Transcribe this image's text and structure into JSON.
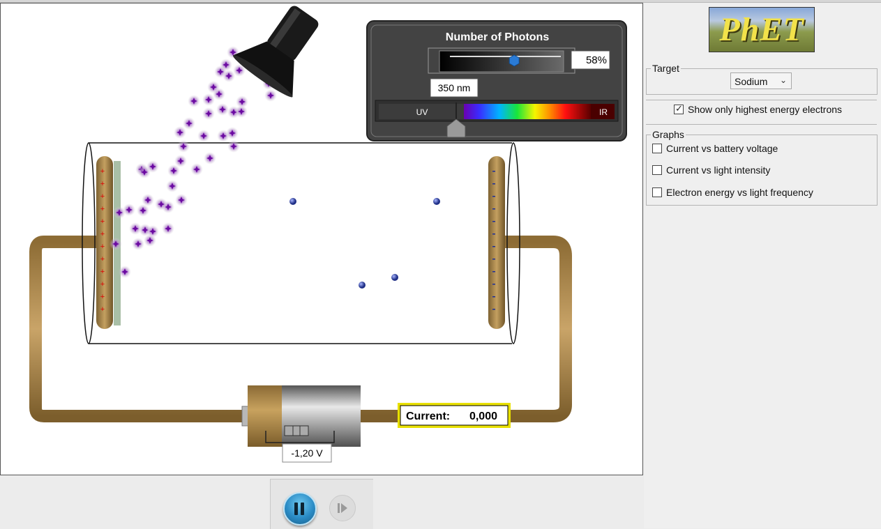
{
  "simulation": {
    "photon_panel": {
      "title": "Number of Photons",
      "intensity_percent": 58,
      "intensity_label": "58%",
      "wavelength_label": "350 nm",
      "spectrum_uv_label": "UV",
      "spectrum_ir_label": "IR"
    },
    "battery": {
      "voltage_label": "-1,20 V"
    },
    "ammeter": {
      "label": "Current:",
      "value": "0,000"
    },
    "colors": {
      "wire": "#a07d45",
      "photon": "#7a1fa8",
      "electron": "#2b3f9a",
      "current_border": "#e8e000"
    }
  },
  "sidebar": {
    "logo_text": "PhET",
    "target": {
      "legend": "Target",
      "selected": "Sodium",
      "icon": "chevron-down-icon"
    },
    "show_highest_label": "Show only highest energy electrons",
    "graphs": {
      "legend": "Graphs",
      "items": [
        {
          "label": "Current vs battery voltage"
        },
        {
          "label": "Current vs light intensity"
        },
        {
          "label": "Electron energy vs light frequency"
        }
      ]
    }
  },
  "playback": {
    "pause_icon": "pause-icon",
    "step_icon": "step-forward-icon"
  }
}
